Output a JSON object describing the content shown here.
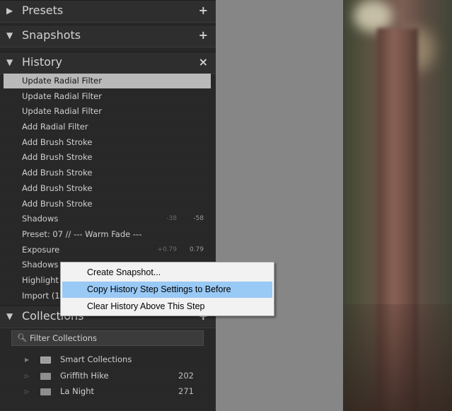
{
  "panels": {
    "presets": {
      "title": "Presets",
      "button": "+"
    },
    "snapshots": {
      "title": "Snapshots",
      "button": "+"
    },
    "history": {
      "title": "History",
      "button": "×"
    },
    "collections": {
      "title": "Collections",
      "button": "+"
    }
  },
  "history": {
    "items": [
      {
        "label": "Update Radial Filter",
        "v1": "",
        "v2": ""
      },
      {
        "label": "Update Radial Filter",
        "v1": "",
        "v2": ""
      },
      {
        "label": "Update Radial Filter",
        "v1": "",
        "v2": ""
      },
      {
        "label": "Add Radial Filter",
        "v1": "",
        "v2": ""
      },
      {
        "label": "Add Brush Stroke",
        "v1": "",
        "v2": ""
      },
      {
        "label": "Add Brush Stroke",
        "v1": "",
        "v2": ""
      },
      {
        "label": "Add Brush Stroke",
        "v1": "",
        "v2": ""
      },
      {
        "label": "Add Brush Stroke",
        "v1": "",
        "v2": ""
      },
      {
        "label": "Add Brush Stroke",
        "v1": "",
        "v2": ""
      },
      {
        "label": "Shadows",
        "v1": "-38",
        "v2": "-58"
      },
      {
        "label": "Preset: 07 // --- Warm Fade ---",
        "v1": "",
        "v2": ""
      },
      {
        "label": "Exposure",
        "v1": "+0.79",
        "v2": "0.79"
      },
      {
        "label": "Shadows",
        "v1": "",
        "v2": ""
      },
      {
        "label": "Highlight",
        "v1": "",
        "v2": ""
      },
      {
        "label": "Import (1",
        "v1": "",
        "v2": ""
      }
    ]
  },
  "collections": {
    "filter_placeholder": "Filter Collections",
    "items": [
      {
        "name": "Smart Collections",
        "count": ""
      },
      {
        "name": "Griffith Hike",
        "count": "202"
      },
      {
        "name": "La Night",
        "count": "271"
      }
    ]
  },
  "context_menu": {
    "items": [
      "Create Snapshot...",
      "Copy History Step Settings to Before",
      "Clear History Above This Step"
    ]
  },
  "icons": {
    "collapsed": "triangle-right-icon",
    "expanded": "triangle-down-icon",
    "search": "magnifier-icon",
    "folder": "collection-folder-icon"
  },
  "colors": {
    "panel_bg": "#282828",
    "selected_row": "#b9b9b9",
    "menu_highlight": "#99c9f5",
    "center_gray": "#868686"
  }
}
